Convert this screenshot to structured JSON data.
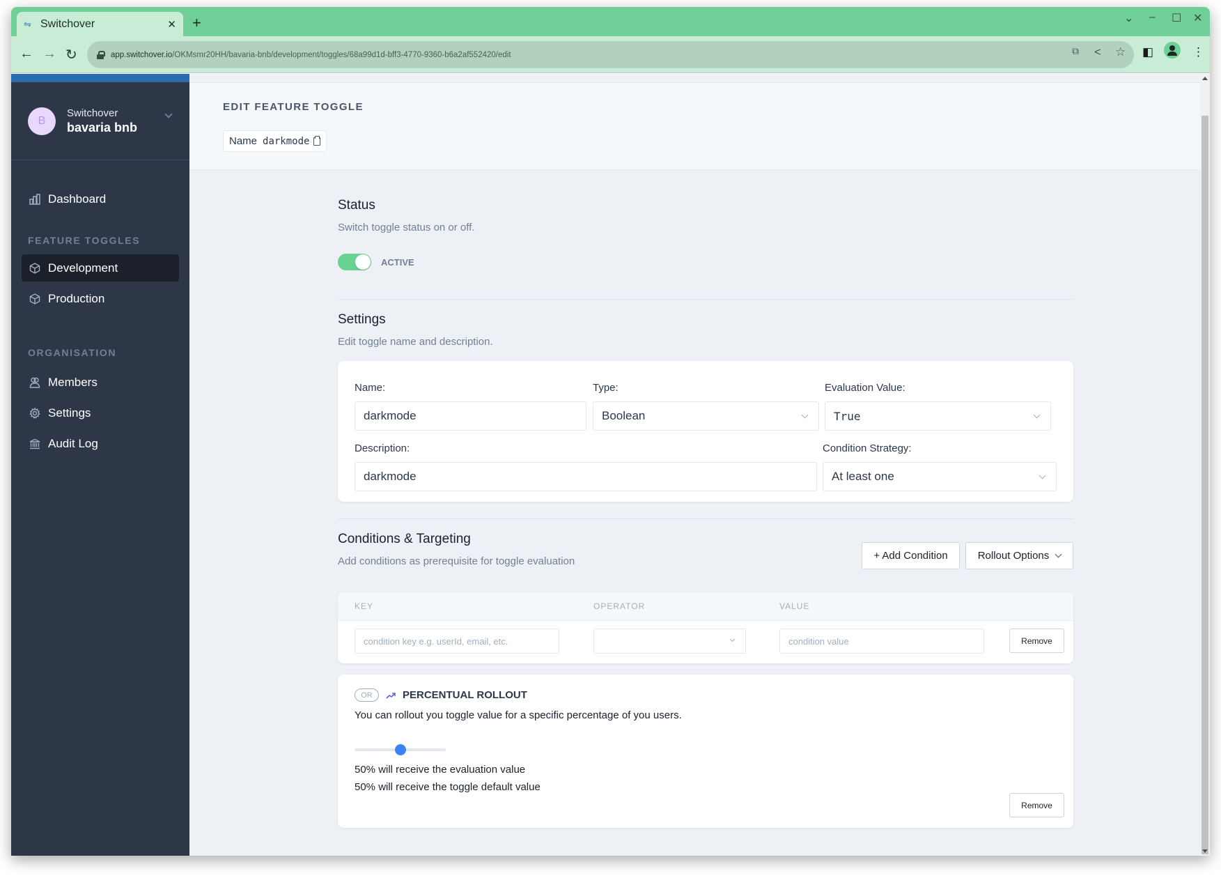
{
  "browser": {
    "tab_title": "Switchover",
    "url_host": "app.switchover.io",
    "url_path": "/OKMsmr20HH/bavaria-bnb/development/toggles/68a99d1d-bff3-4770-9360-b6a2af552420/edit",
    "accent_color": "#6fcf97"
  },
  "sidebar": {
    "org_label": "Switchover",
    "org_name": "bavaria bnb",
    "avatar_letter": "B",
    "dashboard": "Dashboard",
    "sections": [
      {
        "title": "FEATURE TOGGLES",
        "items": [
          {
            "label": "Development",
            "icon": "cube-icon",
            "active": true
          },
          {
            "label": "Production",
            "icon": "cube-icon",
            "active": false
          }
        ]
      },
      {
        "title": "ORGANISATION",
        "items": [
          {
            "label": "Members",
            "icon": "users-icon"
          },
          {
            "label": "Settings",
            "icon": "gear-icon"
          },
          {
            "label": "Audit Log",
            "icon": "bank-icon"
          }
        ]
      }
    ]
  },
  "header": {
    "eyebrow": "EDIT FEATURE TOGGLE",
    "name_label": "Name",
    "name_value": "darkmode"
  },
  "status": {
    "title": "Status",
    "subtitle": "Switch toggle status on or off.",
    "toggle_on": true,
    "toggle_label": "ACTIVE"
  },
  "settings": {
    "title": "Settings",
    "subtitle": "Edit toggle name and description.",
    "name_label": "Name:",
    "name_value": "darkmode",
    "type_label": "Type:",
    "type_value": "Boolean",
    "eval_label": "Evaluation Value:",
    "eval_value": "True",
    "desc_label": "Description:",
    "desc_value": "darkmode",
    "strategy_label": "Condition Strategy:",
    "strategy_value": "At least one"
  },
  "conditions": {
    "title": "Conditions & Targeting",
    "subtitle": "Add conditions as prerequisite for toggle evaluation",
    "add_button": "+ Add Condition",
    "rollout_button": "Rollout Options",
    "columns": {
      "key": "KEY",
      "operator": "OPERATOR",
      "value": "VALUE"
    },
    "rows": [
      {
        "key_placeholder": "condition key e.g. userId, email, etc.",
        "operator": "",
        "value_placeholder": "condition value",
        "remove": "Remove"
      }
    ]
  },
  "rollout": {
    "badge": "OR",
    "title": "PERCENTUAL ROLLOUT",
    "description": "You can rollout you toggle value for a specific percentage of you users.",
    "percentage": 50,
    "line1": "50% will receive the evaluation value",
    "line2": "50% will receive the toggle default value",
    "remove": "Remove",
    "slider_color": "#3b82f6"
  }
}
